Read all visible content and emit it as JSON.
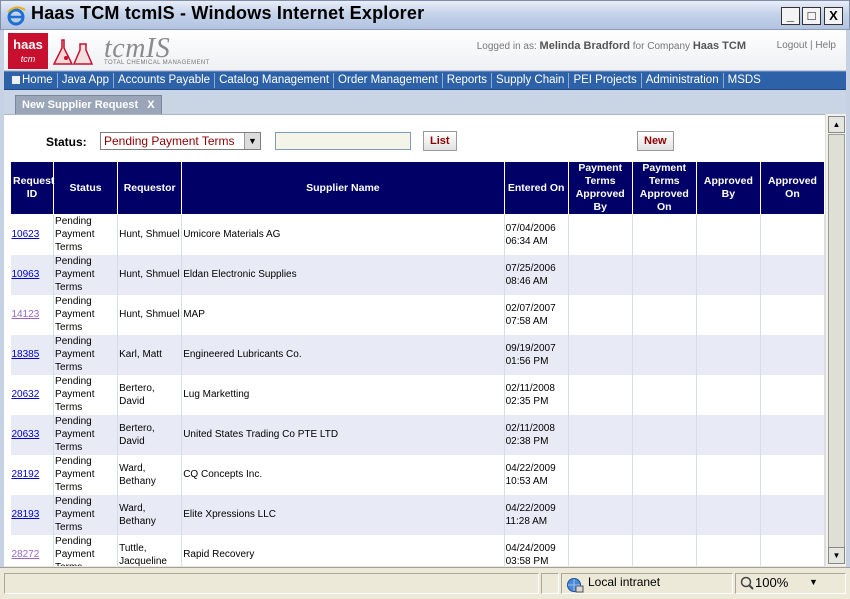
{
  "window": {
    "title": "Haas TCM tcmIS - Windows Internet Explorer",
    "min": "_",
    "max": "□",
    "close": "X"
  },
  "header": {
    "logo_main": "haas",
    "logo_sub": "tcm",
    "brand": "tcmIS",
    "brand_sub": "TOTAL CHEMICAL MANAGEMENT",
    "logged_prefix": "Logged in as:",
    "user": "Melinda Bradford",
    "company_prefix": "for Company",
    "company": "Haas TCM",
    "logout": "Logout",
    "help": "Help"
  },
  "menu": [
    "Home",
    "Java App",
    "Accounts Payable",
    "Catalog Management",
    "Order Management",
    "Reports",
    "Supply Chain",
    "PEI Projects",
    "Administration",
    "MSDS"
  ],
  "tab": {
    "label": "New Supplier Request",
    "close": "X"
  },
  "filters": {
    "status_label": "Status:",
    "status_value": "Pending Payment Terms",
    "search_value": "",
    "list_button": "List",
    "new_button": "New"
  },
  "table": {
    "headers": [
      "Request ID",
      "Status",
      "Requestor",
      "Supplier Name",
      "Entered On",
      "Payment Terms Approved By",
      "Payment Terms Approved On",
      "Approved By",
      "Approved On"
    ],
    "rows": [
      {
        "id": "10623",
        "status": "Pending Payment Terms",
        "requestor": "Hunt, Shmuel",
        "supplier": "Umicore Materials AG",
        "date": "07/04/2006",
        "time": "06:34 AM",
        "visited": false
      },
      {
        "id": "10963",
        "status": "Pending Payment Terms",
        "requestor": "Hunt, Shmuel",
        "supplier": "Eldan Electronic Supplies",
        "date": "07/25/2006",
        "time": "08:46 AM",
        "visited": false
      },
      {
        "id": "14123",
        "status": "Pending Payment Terms",
        "requestor": "Hunt, Shmuel",
        "supplier": "MAP",
        "date": "02/07/2007",
        "time": "07:58 AM",
        "visited": true
      },
      {
        "id": "18385",
        "status": "Pending Payment Terms",
        "requestor": "Karl, Matt",
        "supplier": "Engineered Lubricants Co.",
        "date": "09/19/2007",
        "time": "01:56 PM",
        "visited": false
      },
      {
        "id": "20632",
        "status": "Pending Payment Terms",
        "requestor": "Bertero, David",
        "supplier": "Lug Marketting",
        "date": "02/11/2008",
        "time": "02:35 PM",
        "visited": false
      },
      {
        "id": "20633",
        "status": "Pending Payment Terms",
        "requestor": "Bertero, David",
        "supplier": "United States Trading Co PTE LTD",
        "date": "02/11/2008",
        "time": "02:38 PM",
        "visited": false
      },
      {
        "id": "28192",
        "status": "Pending Payment Terms",
        "requestor": "Ward, Bethany",
        "supplier": "CQ Concepts Inc.",
        "date": "04/22/2009",
        "time": "10:53 AM",
        "visited": false
      },
      {
        "id": "28193",
        "status": "Pending Payment Terms",
        "requestor": "Ward, Bethany",
        "supplier": "Elite Xpressions LLC",
        "date": "04/22/2009",
        "time": "11:28 AM",
        "visited": false
      },
      {
        "id": "28272",
        "status": "Pending Payment Terms",
        "requestor": "Tuttle, Jacqueline",
        "supplier": "Rapid Recovery",
        "date": "04/24/2009",
        "time": "03:58 PM",
        "visited": true
      }
    ]
  },
  "statusbar": {
    "zone": "Local intranet",
    "zoom": "100%"
  },
  "colors": {
    "menu_bg": "#2d62a8",
    "header_bg": "#000066",
    "row_alt": "#e8ebf6",
    "link": "#0000cc",
    "visited_link": "#9966cc",
    "logo_red": "#c8102e"
  }
}
